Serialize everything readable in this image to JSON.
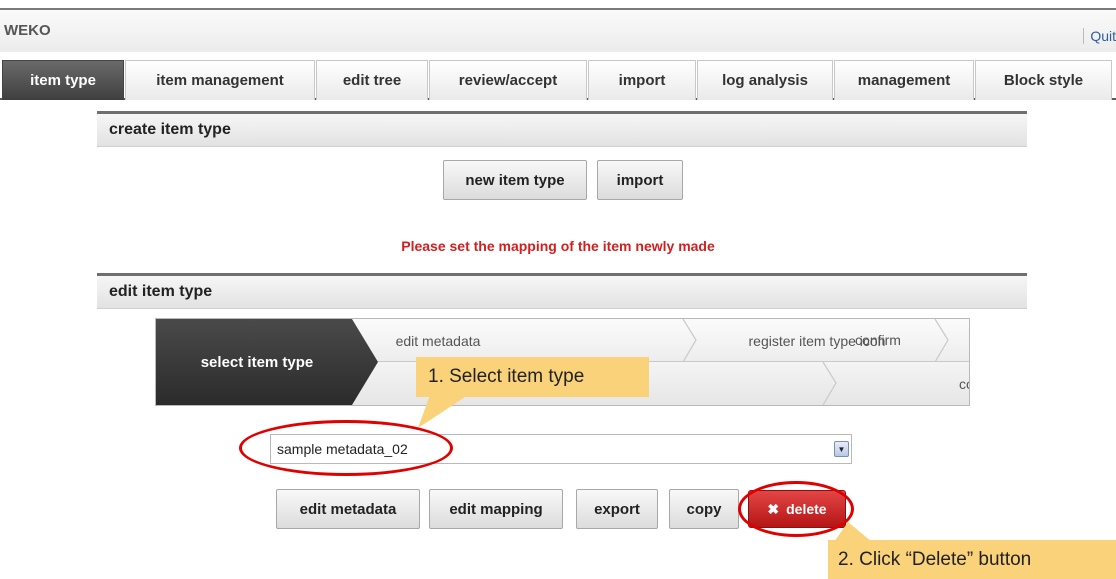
{
  "app": {
    "title": "WEKO",
    "quit_label": "Quit"
  },
  "tabs": [
    {
      "label": "item type"
    },
    {
      "label": "item management"
    },
    {
      "label": "edit tree"
    },
    {
      "label": "review/accept"
    },
    {
      "label": "import"
    },
    {
      "label": "log analysis"
    },
    {
      "label": "management"
    },
    {
      "label": "Block style"
    }
  ],
  "create_section": {
    "header": "create item type",
    "new_item_type_label": "new item type",
    "import_label": "import"
  },
  "notice": "Please set the mapping of the item newly made",
  "edit_section": {
    "header": "edit item type",
    "steps": {
      "active": "select item type",
      "row1": [
        "edit metadata",
        "register item type icon",
        "confirm"
      ],
      "row2": [
        "confirm"
      ]
    },
    "selected_item_type": "sample metadata_02",
    "buttons": {
      "edit_metadata": "edit metadata",
      "edit_mapping": "edit mapping",
      "export": "export",
      "copy": "copy",
      "delete": "delete"
    }
  },
  "annotations": {
    "callout_1": "1. Select item type",
    "callout_2": "2. Click “Delete” button"
  },
  "colors": {
    "active_tab": "#4a4a4a",
    "notice": "#d22020",
    "delete_button": "#c81e1e",
    "callout": "#f9d27a",
    "highlight_ring": "#e00000"
  }
}
